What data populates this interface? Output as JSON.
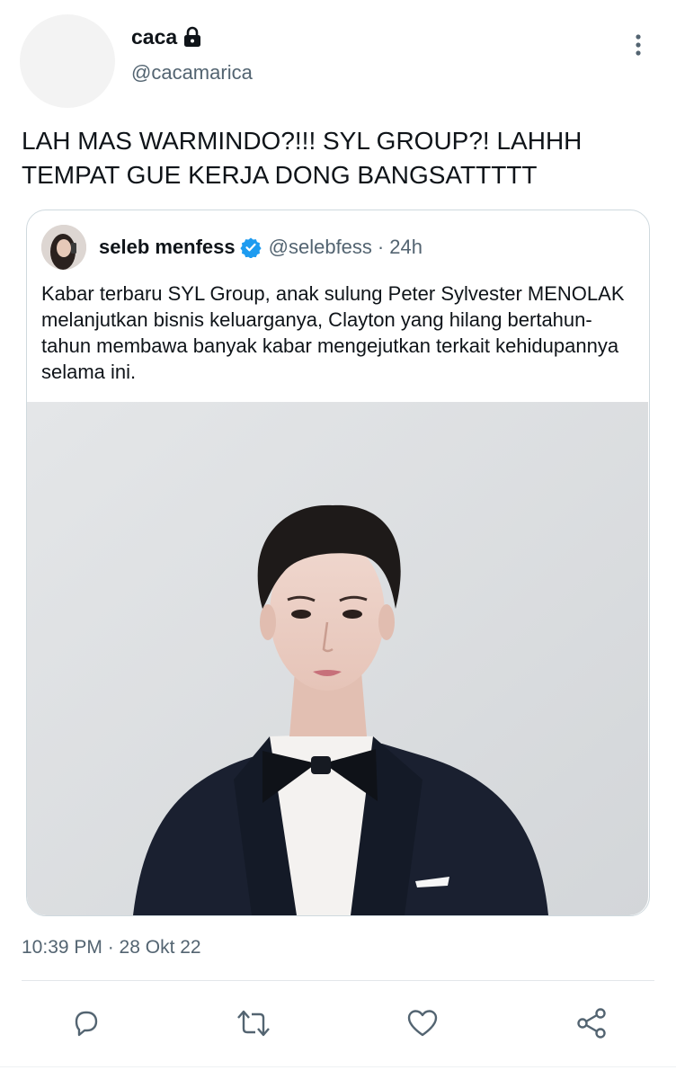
{
  "author": {
    "display_name": "caca",
    "handle": "@cacamarica",
    "locked": true,
    "avatar": "blank-avatar"
  },
  "tweet": {
    "text": "LAH MAS WARMINDO?!!! SYL GROUP?! LAHHH\nTEMPAT GUE KERJA DONG BANGSATTTTT",
    "timestamp": "10:39 PM · 28 Okt 22"
  },
  "quoted": {
    "display_name": "seleb menfess",
    "verified": true,
    "handle": "@selebfess",
    "separator": "·",
    "age": "24h",
    "text": "Kabar terbaru SYL Group, anak sulung Peter Sylvester MENOLAK melanjutkan bisnis keluarganya, Clayton yang hilang bertahun-tahun membawa banyak kabar mengejutkan terkait kehidupannya selama ini.",
    "media": "photo-man-in-tuxedo"
  },
  "icons": {
    "more": "more-vertical-icon",
    "lock": "lock-icon",
    "verified": "verified-badge-icon",
    "reply": "reply-icon",
    "retweet": "retweet-icon",
    "like": "like-icon",
    "share": "share-icon"
  },
  "colors": {
    "text_primary": "#0f1419",
    "text_secondary": "#536471",
    "verified_blue": "#1d9bf0",
    "border": "#cfd9de"
  }
}
